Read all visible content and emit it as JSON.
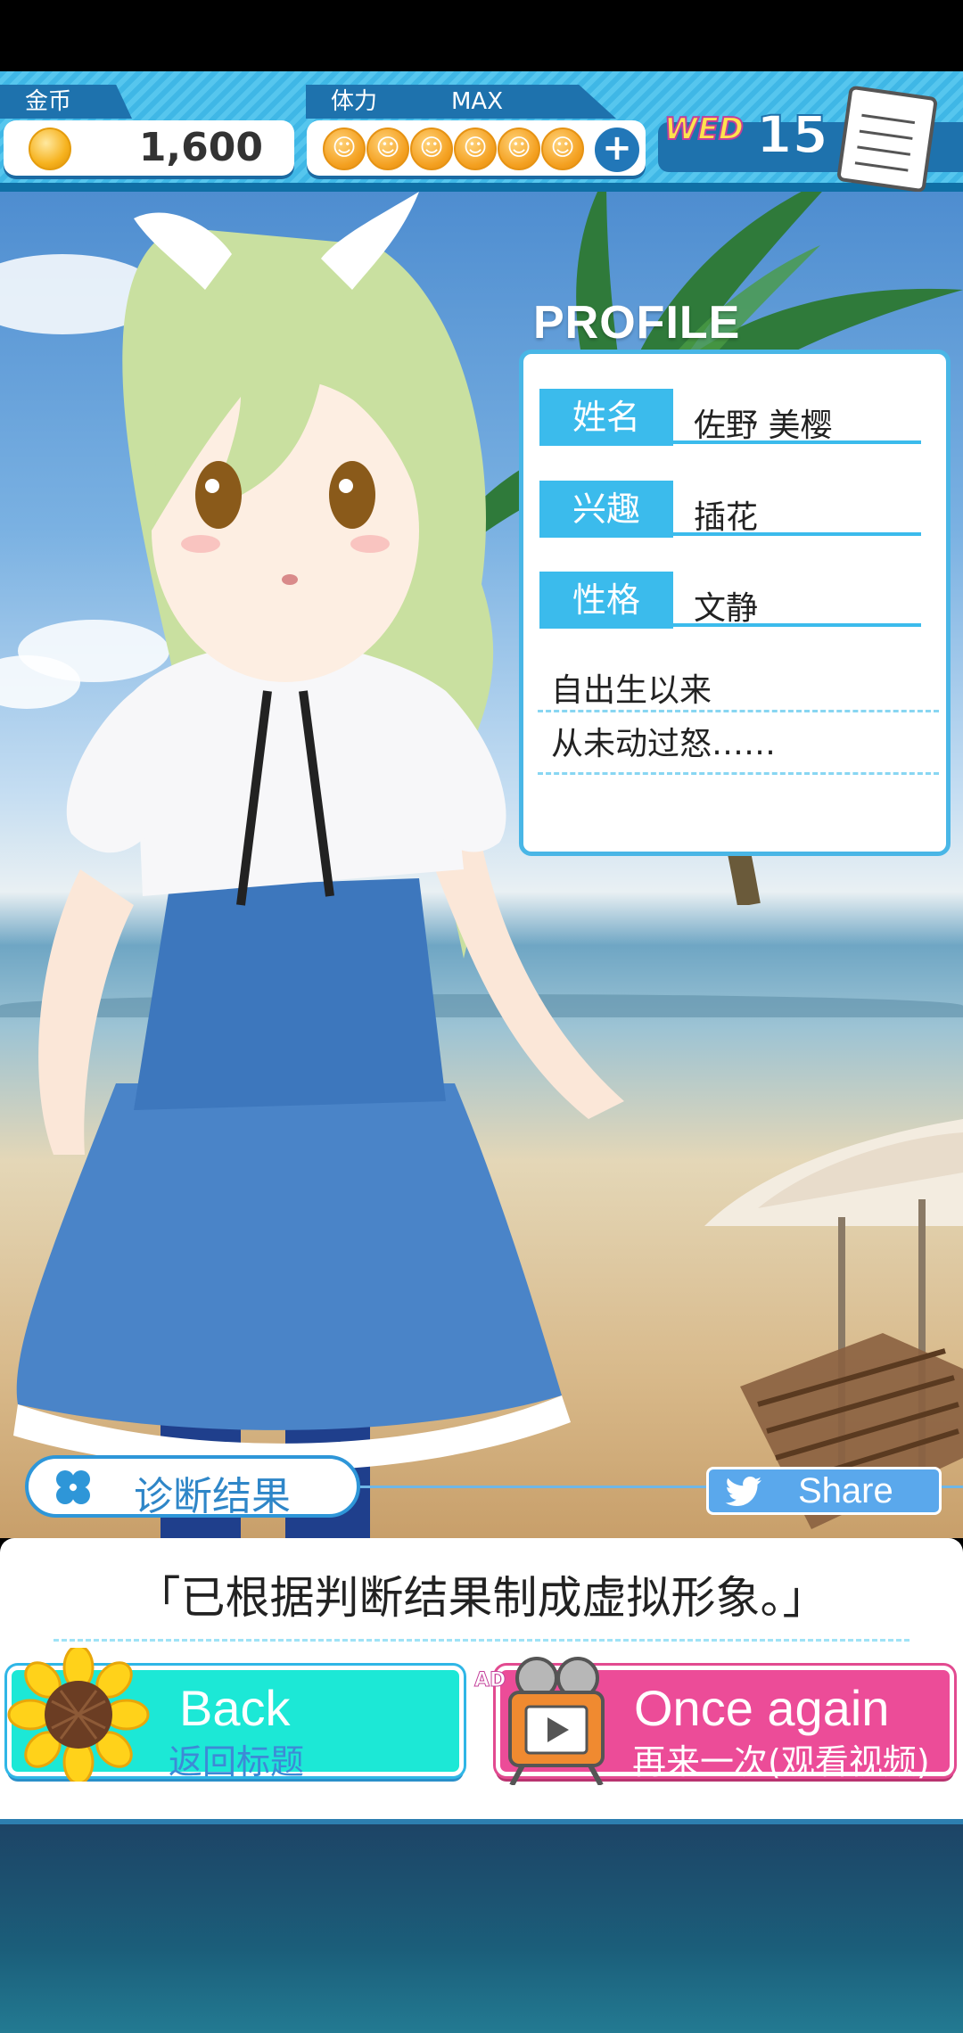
{
  "hud": {
    "coins_label": "金币",
    "coins_value": "1,600",
    "stamina_label": "体力",
    "stamina_max": "MAX",
    "stamina_count": 6,
    "plus_label": "+",
    "weekday": "WED",
    "day": "15"
  },
  "profile": {
    "title": "PROFILE",
    "name_label": "姓名",
    "name_value": "佐野 美樱",
    "hobby_label": "兴趣",
    "hobby_value": "插花",
    "personality_label": "性格",
    "personality_value": "文静",
    "bio_line1": "自出生以来",
    "bio_line2": "从未动过怒……"
  },
  "result": {
    "label": "诊断结果",
    "share_label": "Share",
    "message": "「已根据判断结果制成虚拟形象。」"
  },
  "buttons": {
    "back_label": "Back",
    "back_sub": "返回标题",
    "ad_badge": "AD",
    "again_label": "Once again",
    "again_sub": "再来一次(观看视频)"
  },
  "colors": {
    "hud_blue": "#3fb7e6",
    "accent_blue": "#3bbbec",
    "back_cyan": "#1ce8d6",
    "again_pink": "#ec4c98"
  }
}
